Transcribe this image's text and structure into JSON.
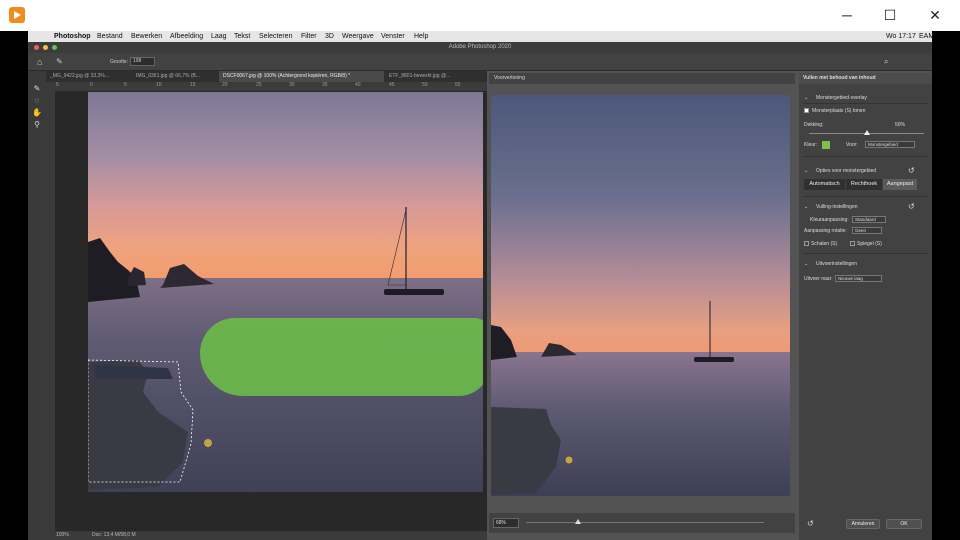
{
  "host": {
    "minimize": "─",
    "maximize": "☐",
    "close": "✕"
  },
  "menubar": {
    "items": [
      "Photoshop",
      "Bestand",
      "Bewerken",
      "Afbeelding",
      "Laag",
      "Tekst",
      "Selecteren",
      "Filter",
      "3D",
      "Weergave",
      "Venster",
      "Help"
    ],
    "clock": "Wo 17:17",
    "trailing": "EAM"
  },
  "window": {
    "title": "Adobe Photoshop 2020"
  },
  "options": {
    "size_label": "Grootte:",
    "size_value": "198"
  },
  "tabs": [
    "_MG_9422.jpg @ 33,3%...",
    "IMG_0361.jpg @ 66,7% (B...",
    "DSCF0067.jpg @ 100% (Achtergrond kopiëren, RGB/8) *",
    "ETF_8801-bewerkt.jpg @..."
  ],
  "ruler": {
    "ticks": [
      "5",
      "0",
      "5",
      "10",
      "15",
      "20",
      "25",
      "30",
      "35",
      "40",
      "45",
      "50",
      "55"
    ]
  },
  "status": {
    "zoom": "100%",
    "doc": "Doc: 13,4 M/58,0 M"
  },
  "preview": {
    "title": "Voorvertoning",
    "zoom": "68%",
    "zoom_fraction": 0.22
  },
  "fill_panel": {
    "title": "Vullen met behoud van inhoud",
    "overlay_section": "Monstergebied-overlay",
    "show_sample": "Monsterplaats (S) tonen",
    "opacity_label": "Dekking:",
    "opacity_value": "50%",
    "opacity_fraction": 0.5,
    "color_label": "Kleur:",
    "color_value": "#7cc24b",
    "for_label": "Voor:",
    "for_value": "Monstergebied",
    "sample_options": "Opties voor monstergebied",
    "seg_buttons": [
      "Automatisch",
      "Rechthoek",
      "Aangepast"
    ],
    "fill_settings": "Vulling-instellingen",
    "color_adapt_label": "Kleuraanpassing:",
    "color_adapt_value": "Standaard",
    "rotation_label": "Aanpassing rotatie:",
    "rotation_value": "Geen",
    "scale_label": "Schalen (S)",
    "mirror_label": "Spiegel (S)",
    "output_section": "Uitvoerinstellingen",
    "output_label": "Uitvoer naar:",
    "output_value": "Nieuwe laag",
    "cancel": "Annuleren",
    "ok": "OK"
  }
}
